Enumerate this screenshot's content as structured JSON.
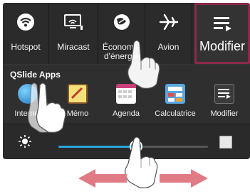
{
  "quick_settings": [
    {
      "label": "Hotspot",
      "icon": "wifi-hotspot-icon"
    },
    {
      "label": "Miracast",
      "icon": "miracast-icon"
    },
    {
      "label": "Économie d'énergie",
      "icon": "energy-saving-icon"
    },
    {
      "label": "Avion",
      "icon": "airplane-icon"
    },
    {
      "label": "Modifier",
      "icon": "edit-list-icon"
    }
  ],
  "qslide": {
    "title": "QSlide Apps",
    "apps": [
      {
        "label": "Internet",
        "icon": "globe-icon"
      },
      {
        "label": "Mémo",
        "icon": "memo-icon"
      },
      {
        "label": "Agenda",
        "icon": "calendar-icon"
      },
      {
        "label": "Calculatrice",
        "icon": "calculator-icon"
      },
      {
        "label": "Modifier",
        "icon": "edit-list-icon"
      }
    ]
  },
  "brightness": {
    "level": 0.52,
    "auto_checked": false
  },
  "colors": {
    "accent": "#2aa7e0",
    "highlight": "#8b2a4a",
    "arrow": "#e07b86"
  }
}
